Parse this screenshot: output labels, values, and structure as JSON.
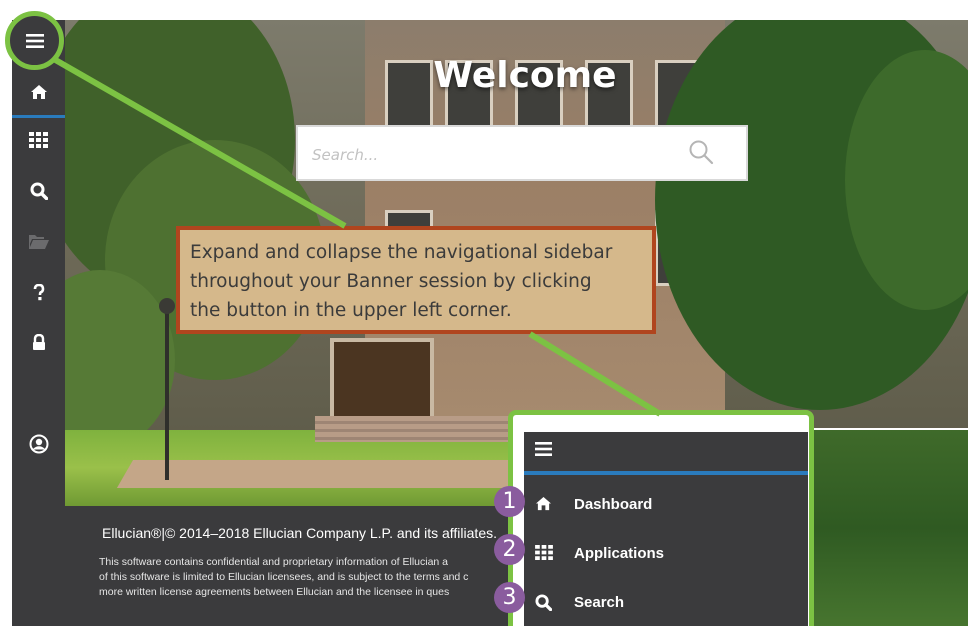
{
  "sidebar": {
    "items": [
      {
        "icon": "menu-icon"
      },
      {
        "icon": "home-icon"
      },
      {
        "icon": "applications-grid-icon"
      },
      {
        "icon": "search-icon"
      },
      {
        "icon": "folder-icon"
      },
      {
        "icon": "help-icon"
      },
      {
        "icon": "lock-icon"
      },
      {
        "icon": "user-profile-icon"
      }
    ]
  },
  "main": {
    "welcome": "Welcome",
    "search_placeholder": "Search..."
  },
  "callout": {
    "line1": "Expand and collapse the navigational sidebar",
    "line2": "throughout your Banner session by clicking",
    "line3": "the button in the upper left corner."
  },
  "footer": {
    "copyright": "Ellucian®|© 2014–2018 Ellucian Company L.P. and its affiliates.",
    "notice_line1": "This software contains confidential and proprietary information of Ellucian a",
    "notice_line2": "of this software is limited to Ellucian licensees, and is subject to the terms and c",
    "notice_line3": "more written license agreements between Ellucian and the licensee in ques"
  },
  "expanded_sidebar": {
    "items": [
      {
        "badge": "1",
        "icon": "home-icon",
        "label": "Dashboard"
      },
      {
        "badge": "2",
        "icon": "applications-grid-icon",
        "label": "Applications"
      },
      {
        "badge": "3",
        "icon": "search-icon",
        "label": "Search"
      }
    ]
  },
  "colors": {
    "sidebar": "#3b3b3d",
    "accent_blue": "#2a7bbd",
    "highlight_green": "#7cc243",
    "callout_bg": "#d5b88b",
    "callout_border": "#b0451e",
    "badge": "#8a5c9e"
  }
}
